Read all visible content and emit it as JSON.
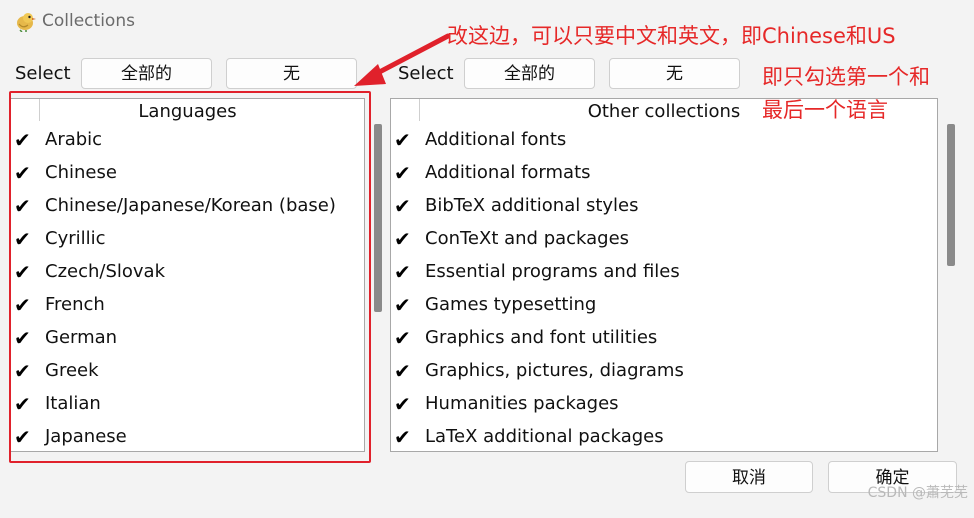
{
  "window": {
    "title": "Collections",
    "icon": "bird-app-icon"
  },
  "left": {
    "select_label": "Select",
    "all_button": "全部的",
    "none_button": "无",
    "header": "Languages",
    "items": [
      {
        "label": "Arabic",
        "checked": true
      },
      {
        "label": "Chinese",
        "checked": true
      },
      {
        "label": "Chinese/Japanese/Korean (base)",
        "checked": true
      },
      {
        "label": "Cyrillic",
        "checked": true
      },
      {
        "label": "Czech/Slovak",
        "checked": true
      },
      {
        "label": "French",
        "checked": true
      },
      {
        "label": "German",
        "checked": true
      },
      {
        "label": "Greek",
        "checked": true
      },
      {
        "label": "Italian",
        "checked": true
      },
      {
        "label": "Japanese",
        "checked": true
      }
    ]
  },
  "right": {
    "select_label": "Select",
    "all_button": "全部的",
    "none_button": "无",
    "header": "Other collections",
    "items": [
      {
        "label": "Additional fonts",
        "checked": true
      },
      {
        "label": "Additional formats",
        "checked": true
      },
      {
        "label": "BibTeX additional styles",
        "checked": true
      },
      {
        "label": "ConTeXt and packages",
        "checked": true
      },
      {
        "label": "Essential programs and files",
        "checked": true
      },
      {
        "label": "Games typesetting",
        "checked": true
      },
      {
        "label": "Graphics and font utilities",
        "checked": true
      },
      {
        "label": "Graphics, pictures, diagrams",
        "checked": true
      },
      {
        "label": "Humanities packages",
        "checked": true
      },
      {
        "label": "LaTeX additional packages",
        "checked": true
      }
    ]
  },
  "footer": {
    "cancel_button": "取消",
    "ok_button": "确定"
  },
  "annotation": {
    "line1": "改这边，可以只要中文和英文，即Chinese和US",
    "line2": "即只勾选第一个和",
    "line3": "最后一个语言",
    "color": "#e62828"
  },
  "watermark": "CSDN @蕭芜芜",
  "check_glyph": "✔"
}
